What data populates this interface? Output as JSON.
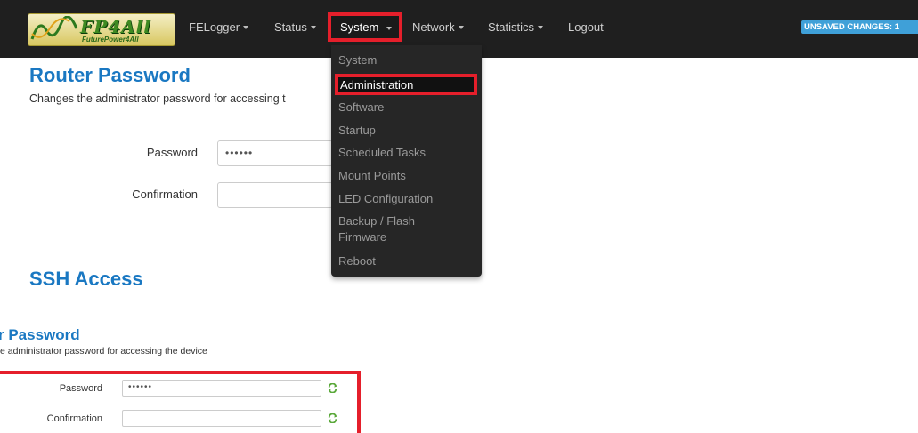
{
  "navbar": {
    "logo": {
      "text": "FP4All",
      "subtext": "FuturePower4All"
    },
    "items": [
      {
        "label": "FELogger"
      },
      {
        "label": "Status"
      },
      {
        "label": "System"
      },
      {
        "label": "Network"
      },
      {
        "label": "Statistics"
      },
      {
        "label": "Logout"
      }
    ],
    "unsaved_badge": "UNSAVED CHANGES: 1"
  },
  "dropdown": {
    "items": [
      {
        "label": "System"
      },
      {
        "label": "Administration"
      },
      {
        "label": "Software"
      },
      {
        "label": "Startup"
      },
      {
        "label": "Scheduled Tasks"
      },
      {
        "label": "Mount Points"
      },
      {
        "label": "LED Configuration"
      },
      {
        "label": "Backup / Flash"
      },
      {
        "label": "Firmware"
      },
      {
        "label": "Reboot"
      }
    ]
  },
  "main": {
    "title": "Router Password",
    "description": "Changes the administrator password for accessing t",
    "password_label": "Password",
    "password_value": "••••••",
    "confirmation_label": "Confirmation",
    "ssh_title": "SSH Access"
  },
  "zoom": {
    "title": "r Password",
    "description": "e administrator password for accessing the device",
    "password_label": "Password",
    "password_value": "••••••",
    "confirmation_label": "Confirmation"
  },
  "colors": {
    "accent": "#1a78c2",
    "highlight": "#e51f2b",
    "navbar": "#1f1f1f",
    "badge": "#3fa0d8"
  }
}
